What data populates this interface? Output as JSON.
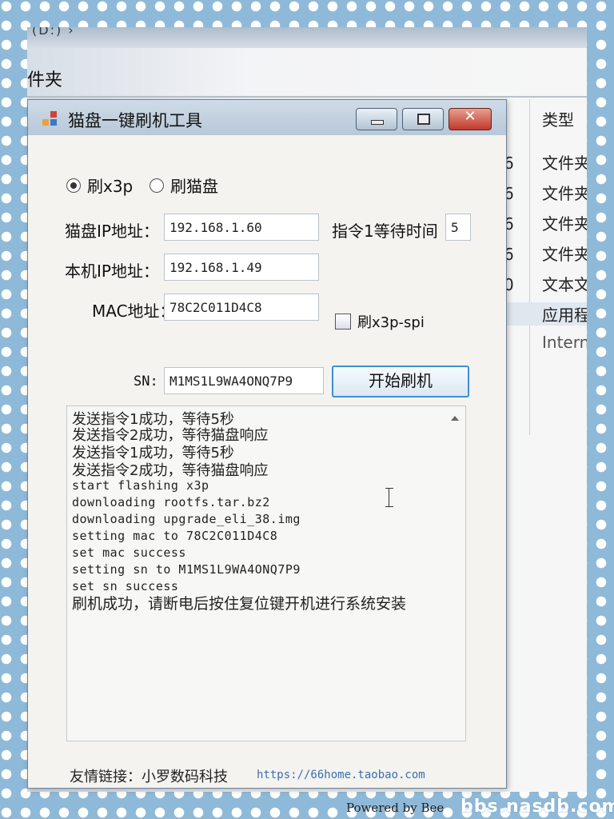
{
  "background": {
    "folder_label": "件夹",
    "breadcrumb": "(D:) ›",
    "type_header": "类型",
    "rows": [
      {
        "date_tail": "6",
        "type": "文件夹"
      },
      {
        "date_tail": "6",
        "type": "文件夹"
      },
      {
        "date_tail": "6",
        "type": "文件夹"
      },
      {
        "date_tail": "6",
        "type": "文件夹"
      },
      {
        "date_tail": "0",
        "type": "文本文"
      },
      {
        "date_tail": "",
        "type": "应用程"
      },
      {
        "date_tail": "",
        "type": "Intern"
      }
    ]
  },
  "window": {
    "title": "猫盘一键刷机工具",
    "close_glyph": "✕"
  },
  "mode": {
    "option_x3p": "刷x3p",
    "option_catdisk": "刷猫盘",
    "selected": "x3p"
  },
  "form": {
    "cat_ip_label": "猫盘IP地址：",
    "cat_ip_value": "192.168.1.60",
    "local_ip_label": "本机IP地址：",
    "local_ip_value": "192.168.1.49",
    "mac_label": "MAC地址：",
    "mac_value": "78C2C011D4C8",
    "sn_label": "SN:",
    "sn_value": "M1MS1L9WA4ONQ7P9",
    "wait_label": "指令1等待时间",
    "wait_value": "5",
    "spi_label": "刷x3p-spi",
    "start_button": "开始刷机"
  },
  "log": [
    "发送指令1成功，等待5秒",
    "发送指令2成功，等待猫盘响应",
    "发送指令1成功，等待5秒",
    "发送指令2成功，等待猫盘响应",
    "start flashing x3p",
    "downloading rootfs.tar.bz2",
    "downloading upgrade_eli_38.img",
    "setting mac to 78C2C011D4C8",
    "set mac success",
    "setting sn to M1MS1L9WA4ONQ7P9",
    "set sn success",
    "刷机成功，请断电后按住复位键开机进行系统安装"
  ],
  "footer": {
    "friend_link_label": "友情链接：小罗数码科技",
    "friend_link_url": "https://66home.taobao.com",
    "powered_by": "Powered by Bee"
  },
  "watermark": "bbs.nasdb.com",
  "colors": {
    "accent_button_border": "#3d8fd6",
    "close_button": "#c0392b",
    "link": "#3a6fb0"
  }
}
